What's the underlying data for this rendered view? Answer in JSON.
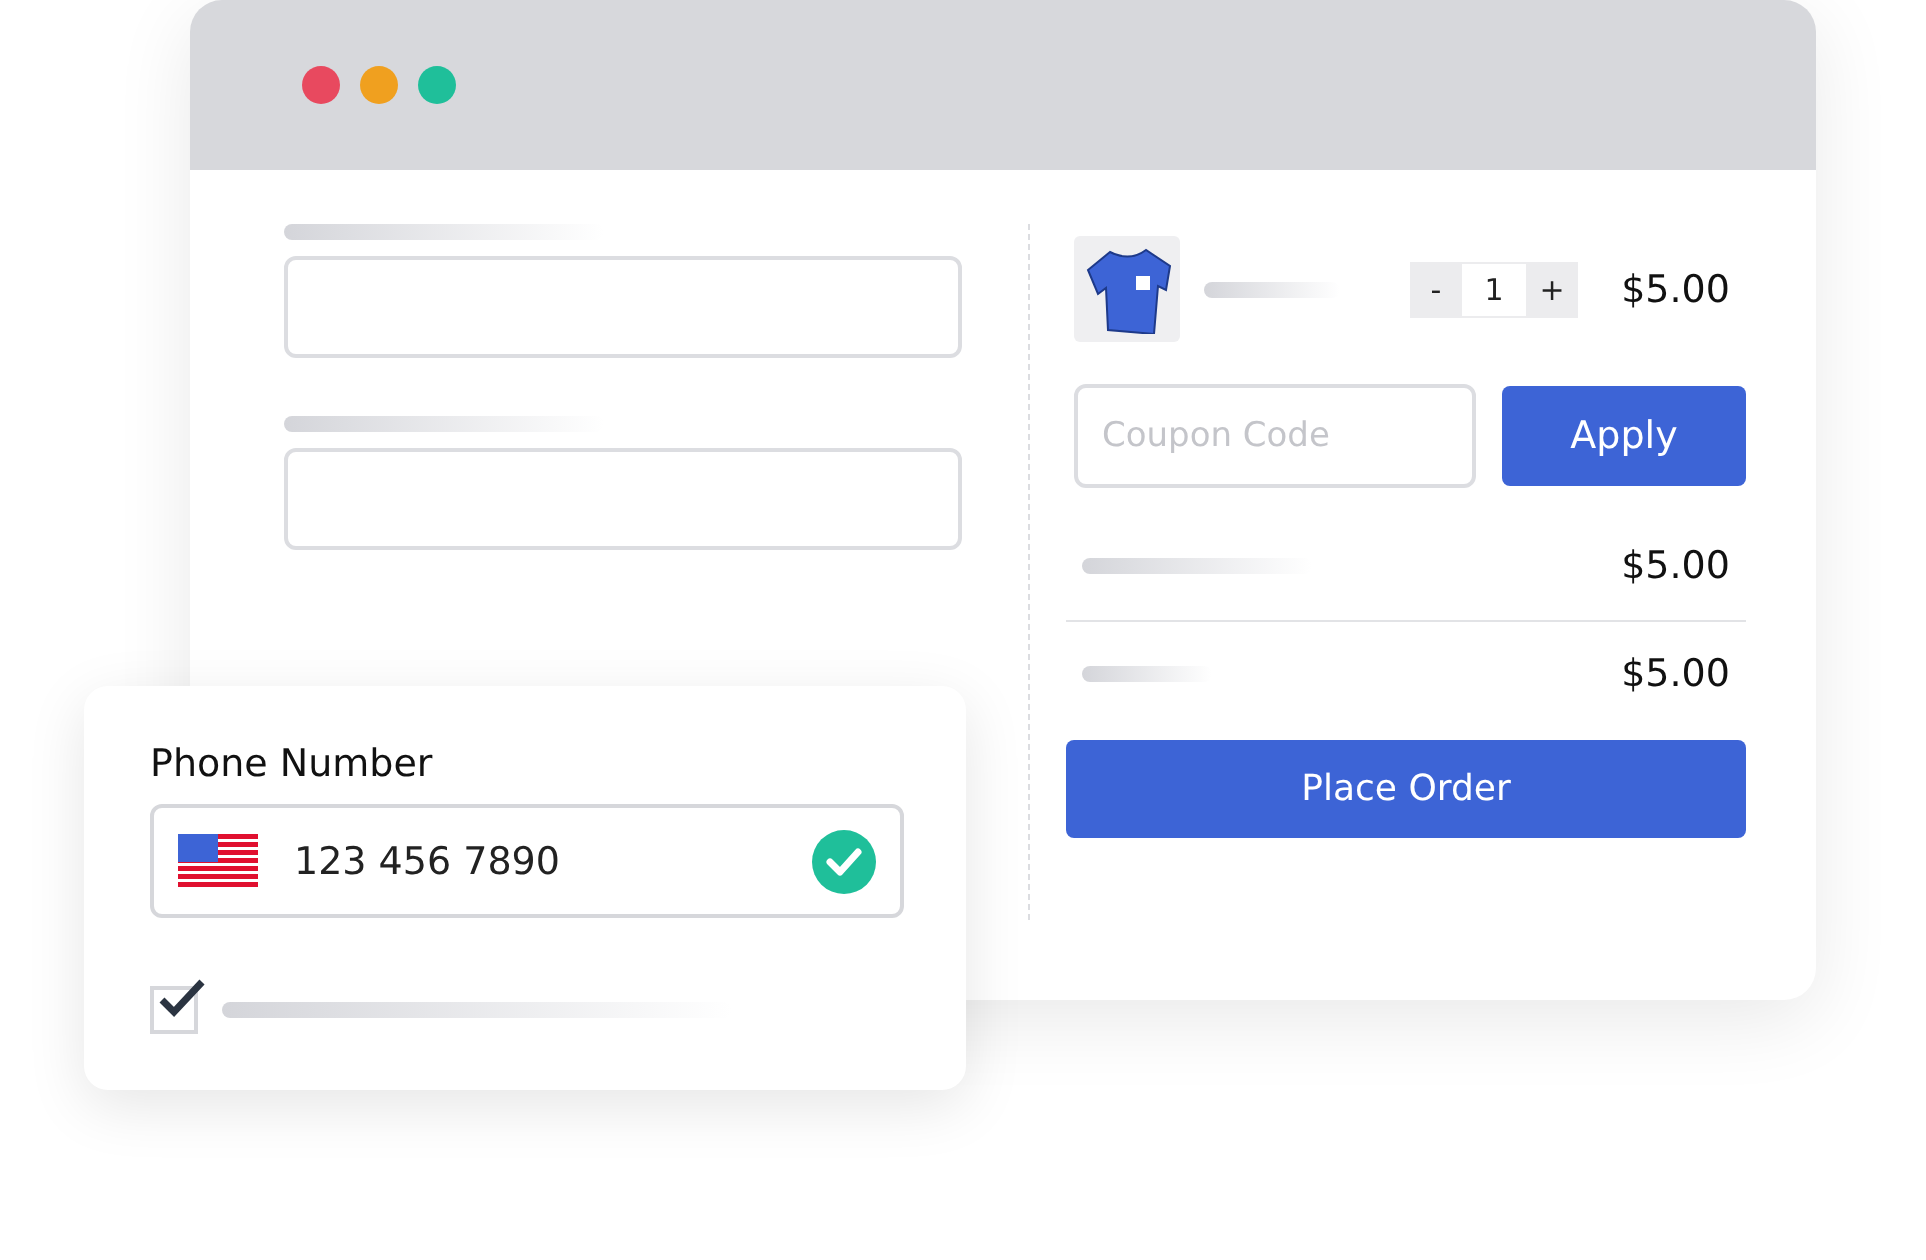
{
  "form": {
    "fields": [
      {
        "kind": "text"
      },
      {
        "kind": "text"
      }
    ]
  },
  "cart": {
    "item": {
      "decrement": "-",
      "quantity": "1",
      "increment": "+",
      "price": "$5.00"
    },
    "coupon": {
      "placeholder": "Coupon Code"
    },
    "apply_button": "Apply",
    "summary": [
      {
        "amount": "$5.00"
      },
      {
        "amount": "$5.00"
      }
    ],
    "place_order_button": "Place Order"
  },
  "phone_card": {
    "label": "Phone Number",
    "value": "123 456 7890",
    "verified": true,
    "checked": true
  }
}
